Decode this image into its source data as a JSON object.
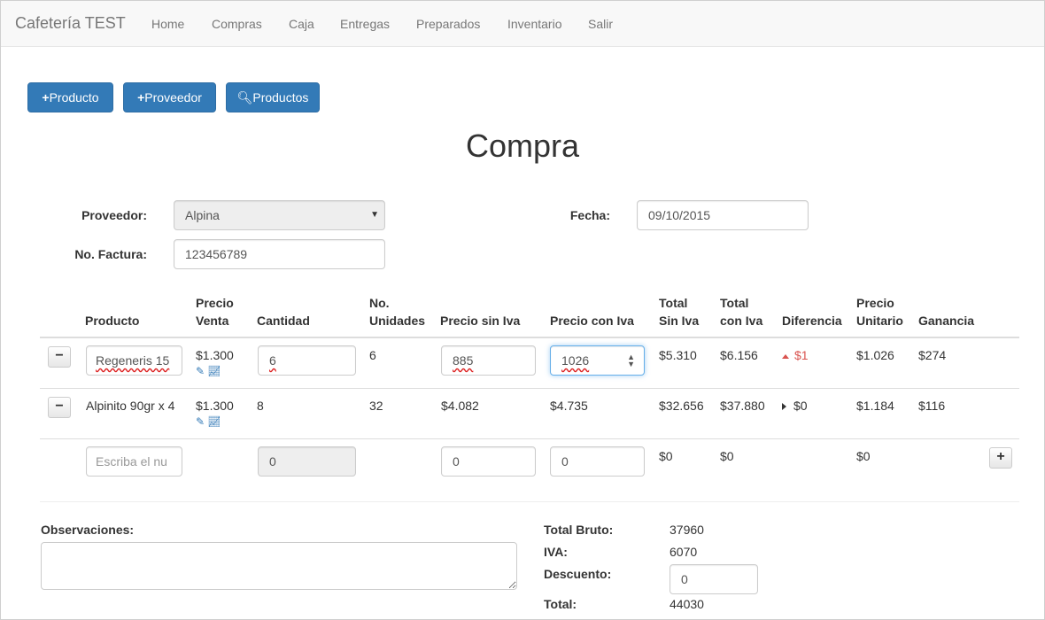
{
  "navbar": {
    "brand": "Cafetería TEST",
    "items": [
      "Home",
      "Compras",
      "Caja",
      "Entregas",
      "Preparados",
      "Inventario",
      "Salir"
    ]
  },
  "toolbar": {
    "buttons": [
      {
        "icon": "plus-icon",
        "label": "Producto"
      },
      {
        "icon": "plus-icon",
        "label": "Proveedor"
      },
      {
        "icon": "search-icon",
        "label": "Productos"
      }
    ]
  },
  "page_title": "Compra",
  "form": {
    "proveedor_label": "Proveedor:",
    "proveedor_value": "Alpina",
    "fecha_label": "Fecha:",
    "fecha_value": "09/10/2015",
    "factura_label": "No. Factura:",
    "factura_value": "123456789"
  },
  "table": {
    "headers": [
      [
        "Producto"
      ],
      [
        "Precio",
        "Venta"
      ],
      [
        "Cantidad"
      ],
      [
        "No.",
        "Unidades"
      ],
      [
        "Precio sin Iva"
      ],
      [
        "Precio con Iva"
      ],
      [
        "Total",
        "Sin Iva"
      ],
      [
        "Total",
        "con Iva"
      ],
      [
        "Diferencia"
      ],
      [
        "Precio",
        "Unitario"
      ],
      [
        "Ganancia"
      ]
    ],
    "rows": [
      {
        "producto": "Regeneris 15",
        "precio_venta": "$1.300",
        "cantidad": "6",
        "unidades": "6",
        "precio_sin_iva": "885",
        "precio_con_iva": "1026",
        "total_sin_iva": "$5.310",
        "total_con_iva": "$6.156",
        "diferencia": "$1",
        "diferencia_dir": "up",
        "precio_unitario": "$1.026",
        "ganancia": "$274"
      },
      {
        "producto": "Alpinito 90gr x 4",
        "precio_venta": "$1.300",
        "cantidad": "8",
        "unidades": "32",
        "precio_sin_iva": "$4.082",
        "precio_con_iva": "$4.735",
        "total_sin_iva": "$32.656",
        "total_con_iva": "$37.880",
        "diferencia": "$0",
        "diferencia_dir": "right",
        "precio_unitario": "$1.184",
        "ganancia": "$116"
      }
    ],
    "new_row": {
      "producto_placeholder": "Escriba el nu",
      "cantidad": "0",
      "precio_sin_iva": "0",
      "precio_con_iva": "0",
      "total_sin_iva": "$0",
      "total_con_iva": "$0",
      "precio_unitario": "$0"
    }
  },
  "observaciones_label": "Observaciones:",
  "totals": {
    "bruto_label": "Total Bruto:",
    "bruto_value": "37960",
    "iva_label": "IVA:",
    "iva_value": "6070",
    "descuento_label": "Descuento:",
    "descuento_value": "0",
    "total_label": "Total:",
    "total_value": "44030"
  },
  "colors": {
    "primary": "#337ab7",
    "danger": "#d9534f"
  }
}
